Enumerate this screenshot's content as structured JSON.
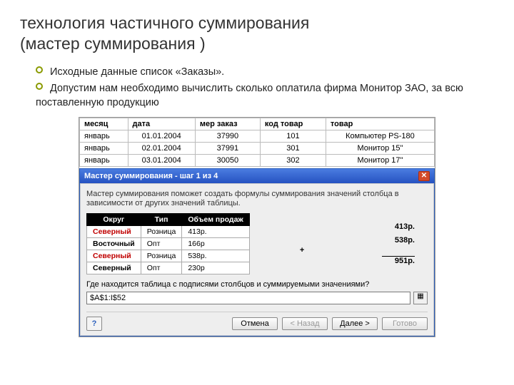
{
  "title_line1": "технология частичного суммирования",
  "title_line2": "(мастер суммирования )",
  "bullets": {
    "b1": "Исходные данные список «Заказы».",
    "b2": "Допустим нам необходимо вычислить сколько оплатила фирма Монитор ЗАО, за всю поставленную продукцию"
  },
  "grid": {
    "headers": [
      "месяц",
      "дата",
      "мер заказ",
      "код товар",
      "товар"
    ],
    "rows": [
      [
        "январь",
        "01.01.2004",
        "37990",
        "101",
        "Компьютер PS-180"
      ],
      [
        "январь",
        "02.01.2004",
        "37991",
        "301",
        "Монитор 15\""
      ],
      [
        "январь",
        "03.01.2004",
        "30050",
        "302",
        "Монитор 17\""
      ]
    ]
  },
  "wizard": {
    "title": "Мастер суммирования - шаг 1 из 4",
    "desc": "Мастер суммирования поможет создать формулы суммирования значений столбца в зависимости от других значений таблицы.",
    "example_headers": [
      "Округ",
      "Тип",
      "Объем продаж"
    ],
    "example_rows": [
      {
        "okrug": "Северный",
        "red": true,
        "tip": "Розница",
        "sum": "413р."
      },
      {
        "okrug": "Восточный",
        "red": false,
        "tip": "Опт",
        "sum": "166р"
      },
      {
        "okrug": "Северный",
        "red": true,
        "tip": "Розница",
        "sum": "538р."
      },
      {
        "okrug": "Северный",
        "red": false,
        "tip": "Опт",
        "sum": "230р"
      }
    ],
    "calc": {
      "a": "413р.",
      "b": "538р.",
      "total": "951р."
    },
    "prompt": "Где находится таблица с подписями столбцов и суммируемыми значениями?",
    "range_value": "$A$1:I$52",
    "buttons": {
      "cancel": "Отмена",
      "back": "< Назад",
      "next": "Далее >",
      "finish": "Готово"
    }
  }
}
